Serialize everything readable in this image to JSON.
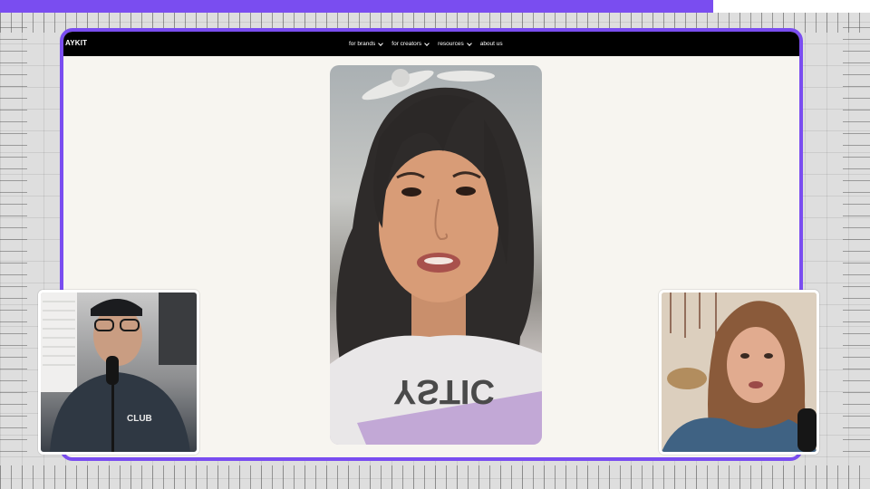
{
  "overlay": {
    "progress_fraction": 0.82,
    "accent_color": "#7a4df0"
  },
  "site": {
    "logo_text": "AYKIT",
    "nav": [
      {
        "label": "for brands",
        "has_dropdown": true
      },
      {
        "label": "for creators",
        "has_dropdown": true
      },
      {
        "label": "resources",
        "has_dropdown": true
      },
      {
        "label": "about us",
        "has_dropdown": false
      }
    ]
  },
  "media": {
    "main_video_shirt_text": "YSTIC",
    "left_cam_shirt_text": "CLUB"
  }
}
